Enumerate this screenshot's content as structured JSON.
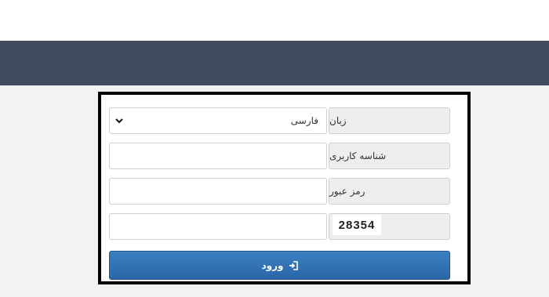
{
  "form": {
    "language": {
      "label": "زبان",
      "selected": "فارسی"
    },
    "username": {
      "label": "شناسه کاربری",
      "value": ""
    },
    "password": {
      "label": "رمز عبور",
      "value": ""
    },
    "captcha": {
      "code": "28354",
      "value": ""
    },
    "submit_label": "ورود"
  },
  "colors": {
    "navbar": "#434b5e",
    "button": "#2f6fb0",
    "background": "#f2f2f2"
  },
  "icons": {
    "select_arrow": "chevron-down-icon",
    "submit": "sign-in-icon"
  }
}
